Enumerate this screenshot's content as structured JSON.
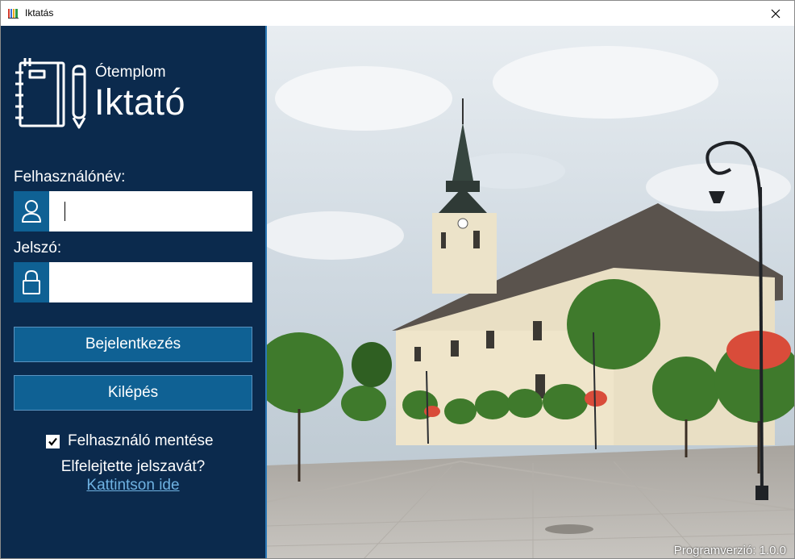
{
  "window": {
    "title": "Iktatás"
  },
  "brand": {
    "small": "Ótemplom",
    "big": "Iktató"
  },
  "form": {
    "username_label": "Felhasználónév:",
    "username_value": "",
    "password_label": "Jelszó:",
    "password_value": "",
    "login_button": "Bejelentkezés",
    "exit_button": "Kilépés",
    "remember_label": "Felhasználó mentése",
    "remember_checked": true,
    "forgot_text": "Elfelejtette jelszavát?",
    "forgot_link": "Kattintson ide"
  },
  "footer": {
    "version": "Programverzió: 1.0.0"
  },
  "icons": {
    "app": "books-icon",
    "logo": "notebook-pencil-icon",
    "user": "user-icon",
    "lock": "lock-icon",
    "close": "close-icon"
  },
  "colors": {
    "panel": "#0b2a4d",
    "accent": "#0f6194",
    "link": "#6fb2e2"
  }
}
